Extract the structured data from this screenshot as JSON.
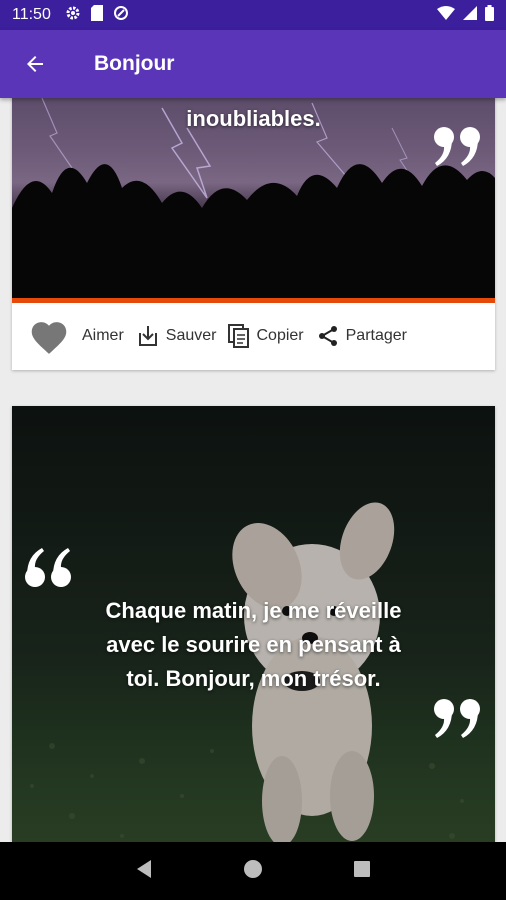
{
  "status_bar": {
    "time": "11:50"
  },
  "app_bar": {
    "title": "Bonjour"
  },
  "cards": [
    {
      "quote_text": "inoubliables.",
      "accent_color": "#e64a0a"
    },
    {
      "quote_text_lines": [
        "Chaque matin, je me réveille",
        "avec le sourire en pensant à",
        "toi. Bonjour, mon trésor."
      ]
    }
  ],
  "actions": {
    "like": "Aimer",
    "save": "Sauver",
    "copy": "Copier",
    "share": "Partager"
  },
  "colors": {
    "status_bar": "#3c1f9c",
    "app_bar": "#5a35b8",
    "accent": "#e64a0a"
  }
}
